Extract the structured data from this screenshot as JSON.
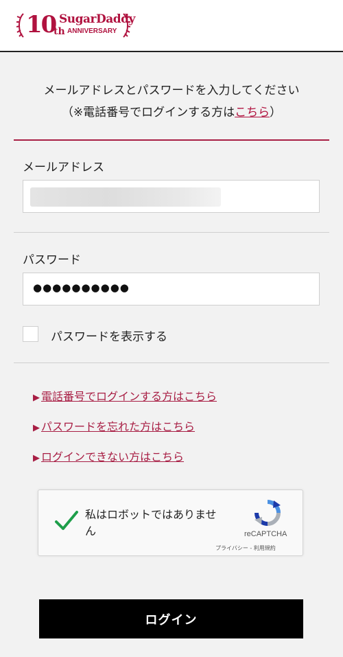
{
  "header": {
    "logo_number": "10",
    "logo_suffix": "th",
    "logo_brand": "SugarDaddy",
    "logo_tagline": "ANNIVERSARY"
  },
  "intro": {
    "line1": "メールアドレスとパスワードを入力してください",
    "line2_prefix": "（※電話番号でログインする方は",
    "line2_link": "こちら",
    "line2_suffix": "）"
  },
  "email": {
    "label": "メールアドレス",
    "value": ""
  },
  "password": {
    "label": "パスワード",
    "masked_value": "●●●●●●●●●●"
  },
  "show_password": {
    "label": "パスワードを表示する",
    "checked": false
  },
  "links": [
    {
      "marker": "▶",
      "label": "電話番号でログインする方はこちら"
    },
    {
      "marker": "▶",
      "label": "パスワードを忘れた方はこちら"
    },
    {
      "marker": "▶",
      "label": "ログインできない方はこちら"
    }
  ],
  "recaptcha": {
    "text": "私はロボットではありません",
    "brand": "reCAPTCHA",
    "terms": "プライバシー - 利用規約",
    "checked": true
  },
  "login_button": {
    "label": "ログイン"
  },
  "colors": {
    "accent": "#a81e44",
    "brand": "#b0123f",
    "background": "#f2f2f2",
    "button": "#000000"
  }
}
